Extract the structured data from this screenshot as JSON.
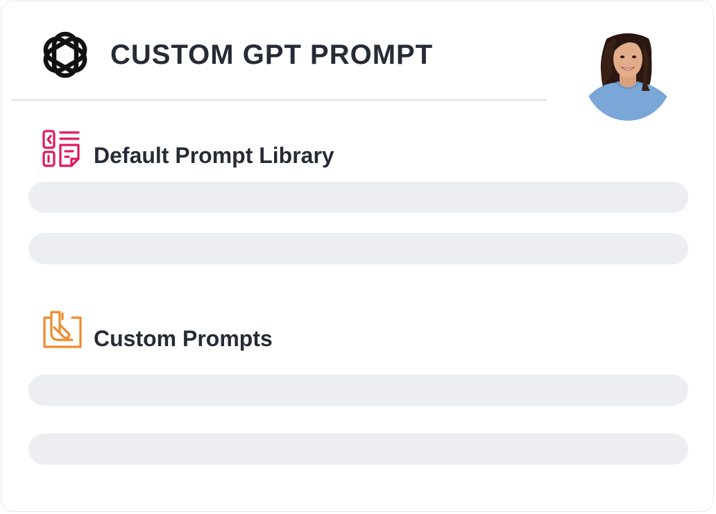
{
  "header": {
    "title": "CUSTOM GPT PROMPT",
    "logo_icon": "openai-logo-icon",
    "avatar": "user-avatar-photo"
  },
  "sections": [
    {
      "title": "Default Prompt Library",
      "icon": "prompt-library-icon",
      "icon_color": "#e0185e",
      "rows": [
        "",
        ""
      ]
    },
    {
      "title": "Custom Prompts",
      "icon": "custom-prompt-edit-icon",
      "icon_color": "#f08a2c",
      "rows": [
        "",
        ""
      ]
    }
  ],
  "colors": {
    "text": "#262b36",
    "placeholder_row": "#eceef2",
    "divider": "#dcdfe4"
  }
}
